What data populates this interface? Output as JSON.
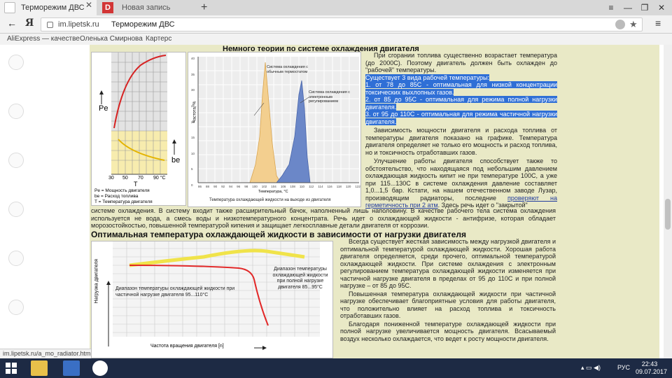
{
  "tabs": {
    "active_label": "Терморежим ДВС",
    "close": "✕",
    "dzen_letter": "D",
    "second_label": "Новая запись",
    "new_tab": "+"
  },
  "window": {
    "tabs_icon": "≡",
    "min": "—",
    "max": "❐",
    "close": "✕"
  },
  "toolbar": {
    "back": "←",
    "logo": "Я",
    "host": "im.lipetsk.ru",
    "title": "Терморежим ДВС",
    "star": "★",
    "menu": "≡"
  },
  "bookmarks": [
    "AliExpress — качестве",
    "Оленька Смирнова",
    "Картерс"
  ],
  "page": {
    "top_heading": "Немного теории  по системе охлаждения двигателя",
    "fig1": {
      "ylabel_pe": "Pe",
      "ylabel_be": "be",
      "xlabel": "T",
      "xticks": [
        "30",
        "50",
        "70",
        "90 °C"
      ],
      "legend": [
        "Pe = Мощность двигателя",
        "be = Расход топлива",
        "T = Температура двигателя"
      ]
    },
    "fig2": {
      "ylabel": "Частота, %",
      "xlabel": "Температура, °C",
      "caption": "Температура охлаждающей жидкости на выходе из двигателя",
      "label_thermostat": "Система охлаждения с обычным термостатом",
      "label_electronic": "Система охлаждения с электронным регулированием",
      "yticks": [
        "40",
        "35",
        "30",
        "25",
        "20",
        "15",
        "10",
        "5",
        "0"
      ],
      "xticks": [
        "86",
        "88",
        "90",
        "92",
        "94",
        "96",
        "98",
        "100",
        "102",
        "104",
        "106",
        "108",
        "110",
        "112",
        "114",
        "116",
        "118",
        "120",
        "122"
      ]
    },
    "right_text": {
      "p1": "При сгорании топлива существенно возрастает температура (до 2000С). Поэтому двигатель должен быть охлажден до \"рабочей\" температуры.",
      "hl1": "Существует 3 вида рабочей температуры:",
      "hl2": "1. от 78 до 85С - оптимальная для низкой концентрации токсических выхлопных газов.",
      "hl3": "2. от 85 до 95С - оптимальная для режима полной нагрузки двигателя.",
      "hl4": "3. от 95 до 110С - оптимальная для режима частичной нагрузки двигателя.",
      "p2": "Зависимость мощности двигателя и расхода топлива от температуры двигателя показано на графике. Температура двигателя определяет не только его мощность и расход топлива, но и токсичность отработавших газов.",
      "p3_a": "Улучшение работы двигателя способствует также то обстоятельство, что находящаяся под небольшим давлением охлаждающая жидкость кипит не при температуре 100С, а уже при 115...130С в системе охлаждения давление составляет 1,0...1,5 бар. Кстати, на нашем отечественном заводе Лузар, производящим радиаторы, последние",
      "p3_link": "проверяют на герметичность при 2 атм",
      "p3_b": ". Здесь речь идет о \"закрытой\""
    },
    "full_para": "системе охлаждения. В систему входит также расширительный бачок,  наполненный лишь наполовину. В качестве рабочего тела система охлаждения используется не вода, а смесь воды и низкотемпературного концентрата. Речь идет о охлаждающей жидкости - антифризе, которая обладает морозостойкостью, повышенной температурой кипения и защищает легкосплавные детали двигателя от коррозии.",
    "heading2": "Оптимальная температура охлаждающей жидкости в зависимости от нагрузки двигателя",
    "fig3": {
      "ylabel": "Нагрузка двигателя",
      "xlabel": "Частота вращения двигателя [n]",
      "label_partial": "Диапазон температуры охлаждающей жидкости при частичной нагрузке двигателя 95...110°С",
      "label_full": "Диапазон температуры охлаждающей жидкости при полной нагрузке двигателя 85...95°С"
    },
    "right_text2": {
      "p1": "Всегда существует жесткая зависимость между нагрузкой двигателя и оптимальной температурой охлаждающей жидкости. Хорошая работа двигателя определяется, среди прочего, оптимальной температурой охлаждающей жидкости. При системе охлаждения с электронным регулированием температура охлаждающей жидкости изменяется при частичной нагрузке двигателя в пределах от 95 до 110С и при полной нагрузке – от 85 до 95С.",
      "p2": "Повышенная температура охлаждающей жидкости при частичной нагрузке обеспечивает благоприятные условия для работы двигателя, что положительно влияет на расход топлива и токсичность отработавших газов.",
      "p3": "Благодаря пониженной температуре охлаждающей жидкости при полной нагрузке увеличивается мощность двигателя. Всасываемый воздух несколько охлаждается, что ведет к росту мощности двигателя."
    }
  },
  "status_url": "im.lipetsk.ru/a_mo_radiator.htm",
  "taskbar": {
    "tray_lang": "РУС",
    "time": "22:43",
    "date": "09.07.2017"
  }
}
